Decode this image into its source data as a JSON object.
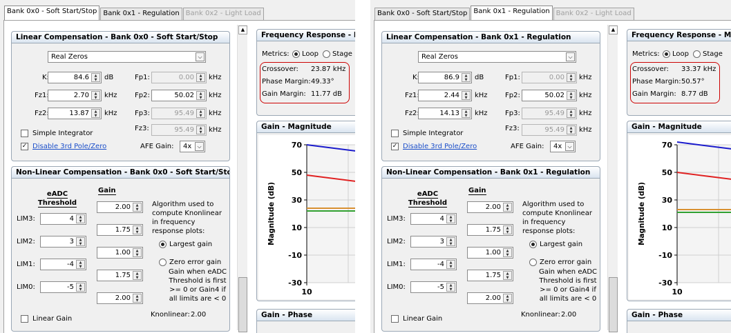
{
  "windows": [
    {
      "tabs": [
        {
          "label": "Bank 0x0 - Soft Start/Stop",
          "state": "active"
        },
        {
          "label": "Bank 0x1 - Regulation",
          "state": "normal"
        },
        {
          "label": "Bank 0x2 - Light Load",
          "state": "disabled"
        }
      ],
      "linear": {
        "title": "Linear Compensation - Bank 0x0 - Soft Start/Stop",
        "zeros_select": "Real Zeros",
        "k_label": "K:",
        "k": "84.6",
        "k_unit": "dB",
        "fz1_label": "Fz1:",
        "fz1": "2.70",
        "fz1_unit": "kHz",
        "fz2_label": "Fz2:",
        "fz2": "13.87",
        "fz2_unit": "kHz",
        "fp1_label": "Fp1:",
        "fp1": "0.00",
        "fp1_unit": "kHz",
        "fp2_label": "Fp2:",
        "fp2": "50.02",
        "fp2_unit": "kHz",
        "fp3_label": "Fp3:",
        "fp3": "95.49",
        "fp3_unit": "kHz",
        "fz3_label": "Fz3:",
        "fz3": "95.49",
        "fz3_unit": "kHz",
        "simple_integrator": "Simple Integrator",
        "disable_pole": "Disable 3rd Pole/Zero",
        "afe_gain_label": "AFE Gain:",
        "afe_gain": "4x"
      },
      "nonlinear": {
        "title": "Non-Linear Compensation - Bank 0x0 - Soft Start/Stop",
        "eadc_header": "eADC Threshold",
        "gain_header": "Gain",
        "lims": [
          {
            "label": "LIM3:",
            "value": "4"
          },
          {
            "label": "LIM2:",
            "value": "3"
          },
          {
            "label": "LIM1:",
            "value": "-4"
          },
          {
            "label": "LIM0:",
            "value": "-5"
          }
        ],
        "gains": [
          "2.00",
          "1.75",
          "1.00",
          "1.75",
          "2.00"
        ],
        "algo_text": "Algorithm used to compute Knonlinear in frequency response plots:",
        "largest_gain": "Largest gain",
        "zero_error": "Zero error gain",
        "zero_error_desc": "Gain when eADC Threshold is first >= 0 or Gain4 if all limits are < 0",
        "linear_gain": "Linear Gain",
        "knonlinear_label": "Knonlinear:",
        "knonlinear": "2.00"
      },
      "freq": {
        "title": "Frequency Response - M",
        "metrics_label": "Metrics:",
        "loop": "Loop",
        "stage": "Stage",
        "crossover_label": "Crossover:",
        "crossover": "23.87 kHz",
        "phase_margin_label": "Phase Margin:",
        "phase_margin": "49.33°",
        "gain_margin_label": "Gain Margin:",
        "gain_margin": "11.77 dB"
      },
      "gain_mag_title": "Gain - Magnitude",
      "gain_phase_title": "Gain - Phase"
    },
    {
      "tabs": [
        {
          "label": "Bank 0x0 - Soft Start/Stop",
          "state": "normal"
        },
        {
          "label": "Bank 0x1 - Regulation",
          "state": "active"
        },
        {
          "label": "Bank 0x2 - Light Load",
          "state": "disabled"
        }
      ],
      "linear": {
        "title": "Linear Compensation - Bank 0x1 - Regulation",
        "zeros_select": "Real Zeros",
        "k_label": "K:",
        "k": "86.9",
        "k_unit": "dB",
        "fz1_label": "Fz1:",
        "fz1": "2.44",
        "fz1_unit": "kHz",
        "fz2_label": "Fz2:",
        "fz2": "14.13",
        "fz2_unit": "kHz",
        "fp1_label": "Fp1:",
        "fp1": "0.00",
        "fp1_unit": "kHz",
        "fp2_label": "Fp2:",
        "fp2": "50.02",
        "fp2_unit": "kHz",
        "fp3_label": "Fp3:",
        "fp3": "95.49",
        "fp3_unit": "kHz",
        "fz3_label": "Fz3:",
        "fz3": "95.49",
        "fz3_unit": "kHz",
        "simple_integrator": "Simple Integrator",
        "disable_pole": "Disable 3rd Pole/Zero",
        "afe_gain_label": "AFE Gain:",
        "afe_gain": "4x"
      },
      "nonlinear": {
        "title": "Non-Linear Compensation - Bank 0x1 - Regulation",
        "eadc_header": "eADC Threshold",
        "gain_header": "Gain",
        "lims": [
          {
            "label": "LIM3:",
            "value": "4"
          },
          {
            "label": "LIM2:",
            "value": "3"
          },
          {
            "label": "LIM1:",
            "value": "-4"
          },
          {
            "label": "LIM0:",
            "value": "-5"
          }
        ],
        "gains": [
          "2.00",
          "1.75",
          "1.00",
          "1.75",
          "2.00"
        ],
        "algo_text": "Algorithm used to compute Knonlinear in frequency response plots:",
        "largest_gain": "Largest gain",
        "zero_error": "Zero error gain",
        "zero_error_desc": "Gain when eADC Threshold is first >= 0 or Gain4 if all limits are < 0",
        "linear_gain": "Linear Gain",
        "knonlinear_label": "Knonlinear:",
        "knonlinear": "2.00"
      },
      "freq": {
        "title": "Frequency Response - M",
        "metrics_label": "Metrics:",
        "loop": "Loop",
        "stage": "Stage",
        "crossover_label": "Crossover:",
        "crossover": "33.37 kHz",
        "phase_margin_label": "Phase Margin:",
        "phase_margin": "50.57°",
        "gain_margin_label": "Gain Margin:",
        "gain_margin": "8.77 dB"
      },
      "gain_mag_title": "Gain - Magnitude",
      "gain_phase_title": "Gain - Phase"
    }
  ],
  "chart_data": [
    {
      "type": "line",
      "ylabel": "Magnitude (dB)",
      "yticks": [
        "70",
        "50",
        "30",
        "10",
        "-10",
        "-30"
      ],
      "ylim": [
        -30,
        70
      ],
      "xtick": "10",
      "series": [
        {
          "color": "#1a1acc",
          "y": [
            70,
            62
          ]
        },
        {
          "color": "#e02020",
          "y": [
            48,
            40
          ]
        },
        {
          "color": "#d89030",
          "y": [
            24,
            24
          ]
        },
        {
          "color": "#30a030",
          "y": [
            22,
            22
          ]
        }
      ]
    },
    {
      "type": "line",
      "ylabel": "Magnitude (dB)",
      "yticks": [
        "70",
        "50",
        "30",
        "10",
        "-10",
        "-30"
      ],
      "ylim": [
        -30,
        70
      ],
      "xtick": "10",
      "series": [
        {
          "color": "#1a1acc",
          "y": [
            72,
            64
          ]
        },
        {
          "color": "#e02020",
          "y": [
            50,
            42
          ]
        },
        {
          "color": "#d89030",
          "y": [
            23,
            23
          ]
        },
        {
          "color": "#30a030",
          "y": [
            21,
            21
          ]
        }
      ]
    }
  ]
}
